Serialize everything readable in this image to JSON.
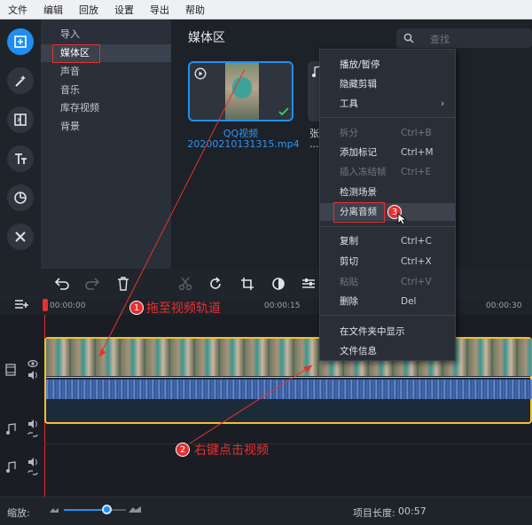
{
  "menubar": [
    "文件",
    "编辑",
    "回放",
    "设置",
    "导出",
    "帮助"
  ],
  "left_tools": [
    "import-icon",
    "magic-wand-icon",
    "transition-icon",
    "text-icon",
    "clock-icon",
    "tools-icon"
  ],
  "categories": [
    "导入",
    "媒体区",
    "声音",
    "音乐",
    "库存视频",
    "背景"
  ],
  "media": {
    "title": "媒体区",
    "search_placeholder": "查找",
    "clip_name_line1": "QQ视频",
    "clip_name_line2": "20200210131315.mp4",
    "partial_clip_line1": "张",
    "partial_clip_line2": "...C"
  },
  "context_menu": {
    "items": [
      {
        "label": "播放/暂停",
        "shortcut": "",
        "disabled": false
      },
      {
        "label": "隐藏剪辑",
        "shortcut": "",
        "disabled": false
      },
      {
        "label": "工具",
        "shortcut": "",
        "disabled": false
      },
      {
        "label": "拆分",
        "shortcut": "Ctrl+B",
        "disabled": true
      },
      {
        "label": "添加标记",
        "shortcut": "Ctrl+M",
        "disabled": false
      },
      {
        "label": "插入冻结帧",
        "shortcut": "Ctrl+E",
        "disabled": true
      },
      {
        "label": "检测场景",
        "shortcut": "",
        "disabled": false
      },
      {
        "label": "分离音频",
        "shortcut": "",
        "disabled": false
      },
      {
        "label": "复制",
        "shortcut": "Ctrl+C",
        "disabled": false
      },
      {
        "label": "剪切",
        "shortcut": "Ctrl+X",
        "disabled": false
      },
      {
        "label": "粘贴",
        "shortcut": "Ctrl+V",
        "disabled": true
      },
      {
        "label": "删除",
        "shortcut": "Del",
        "disabled": false
      },
      {
        "label": "在文件夹中显示",
        "shortcut": "",
        "disabled": false
      },
      {
        "label": "文件信息",
        "shortcut": "",
        "disabled": false
      }
    ]
  },
  "ruler": [
    "00:00:00",
    "00:00:15",
    "00:00:30"
  ],
  "annotations": {
    "step1": "1",
    "step1_text": "拖至视频轨道",
    "step2": "2",
    "step2_text": "右键点击视频",
    "step3": "3"
  },
  "status": {
    "zoom_label": "缩放:",
    "duration_label": "项目长度:",
    "duration_value": "00:57"
  },
  "zoom_level": 0.68,
  "colors": {
    "accent": "#1e8ff0",
    "annotation": "#e53030",
    "clip_border": "#f2c12e"
  }
}
